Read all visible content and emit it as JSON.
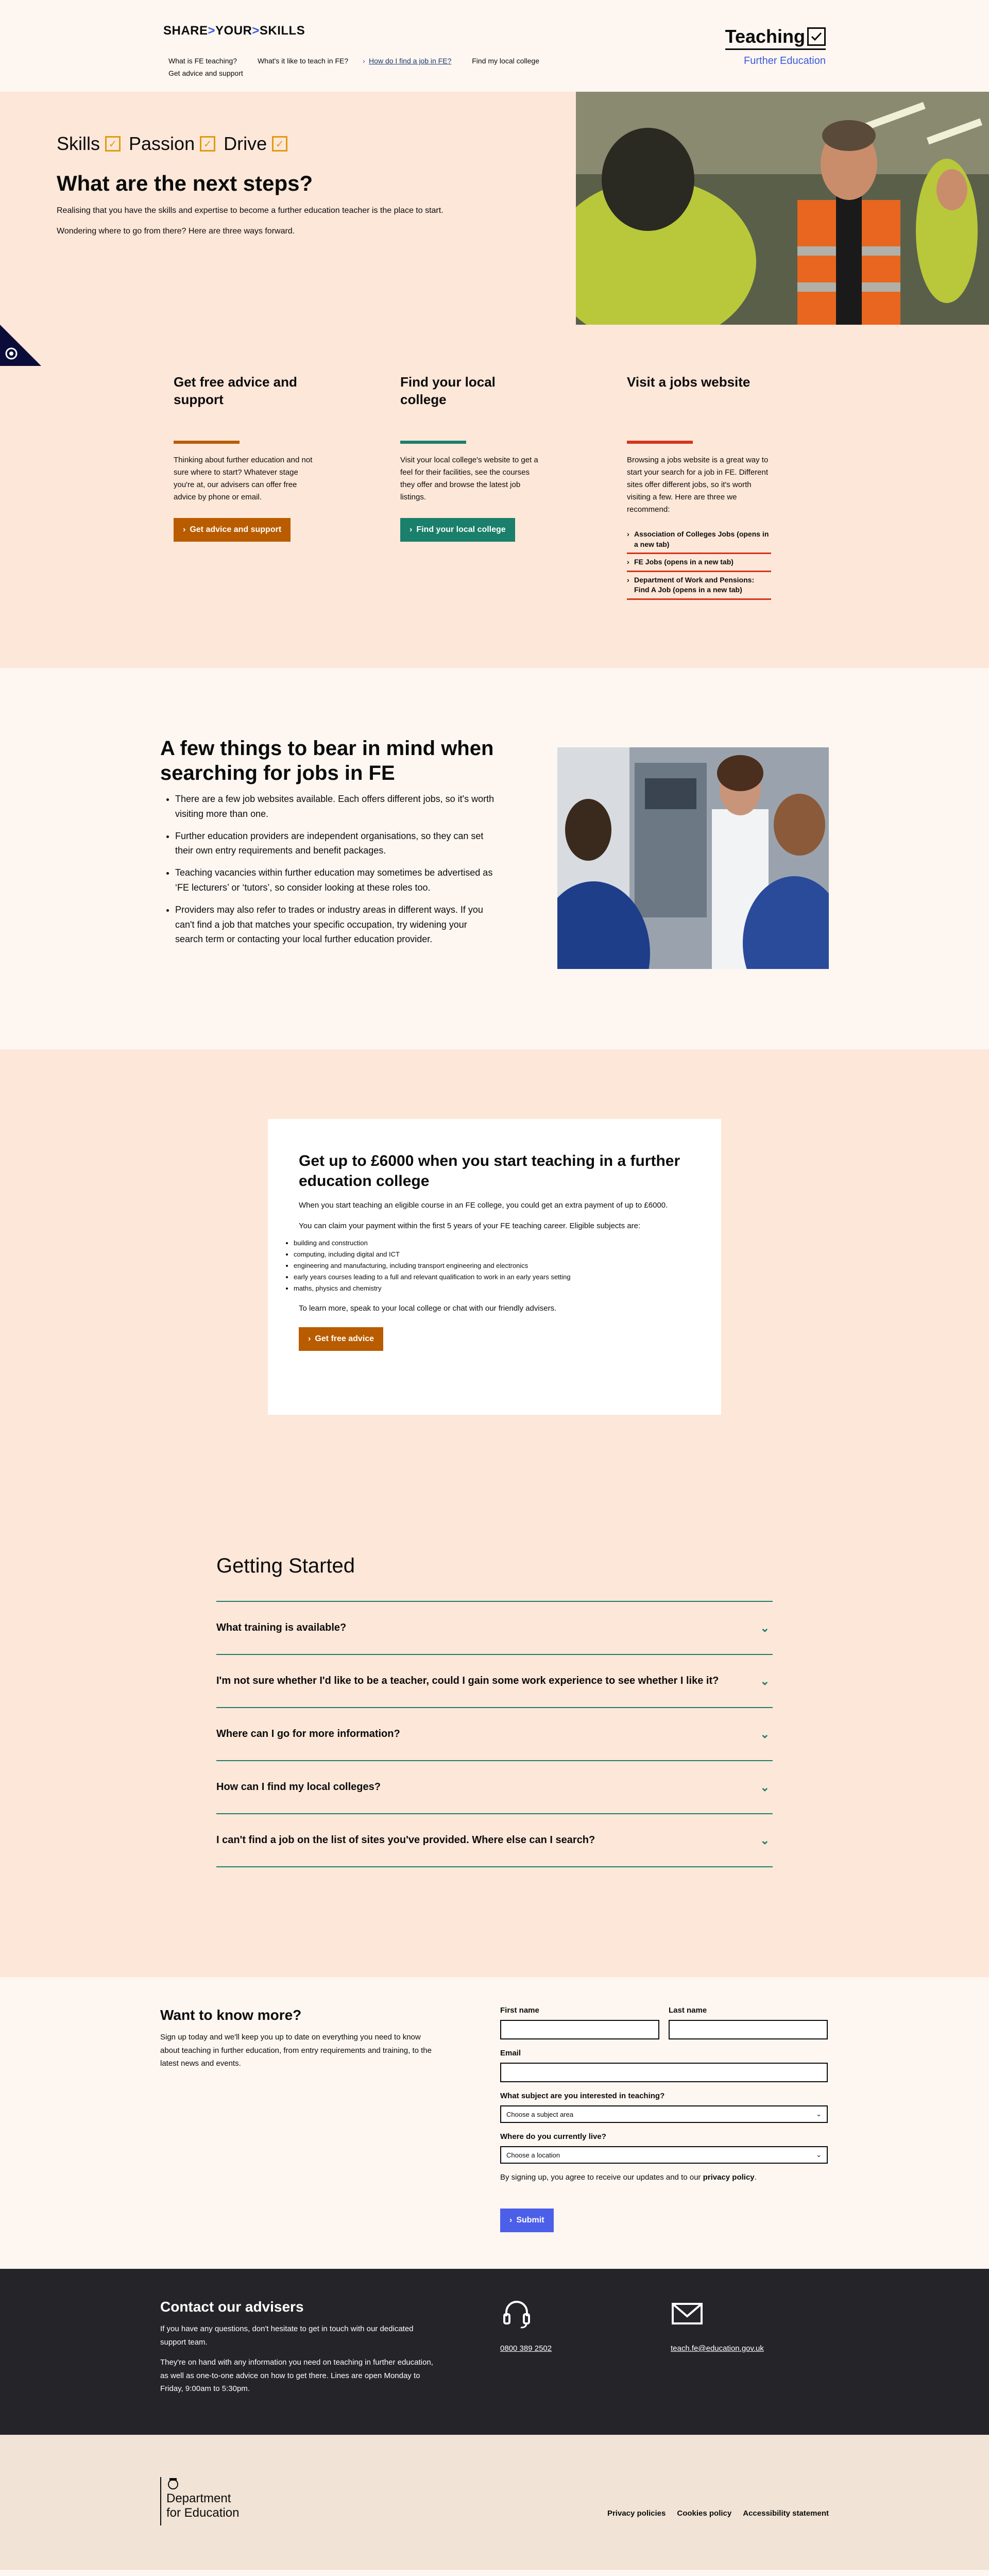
{
  "header": {
    "logo_share": "SHARE",
    "logo_your": "YOUR",
    "logo_skills": "SKILLS",
    "brand_title": "Teaching",
    "brand_sub": "Further Education",
    "nav": [
      "What is FE teaching?",
      "What's it like to teach in FE?",
      "How do I find a job in FE?",
      "Find my local college",
      "Get advice and support"
    ]
  },
  "hero": {
    "pills": [
      "Skills",
      "Passion",
      "Drive"
    ],
    "title": "What are the next steps?",
    "p1": "Realising that you have the skills and expertise to become a further education teacher is the place to start.",
    "p2": "Wondering where to go from there? Here are three ways forward."
  },
  "steps": {
    "col1": {
      "title": "Get free advice and support",
      "text": "Thinking about further education and not sure where to start? Whatever stage you're at, our advisers can offer free advice by phone or email.",
      "button": "Get advice and support",
      "rule_color": "#b95c00"
    },
    "col2": {
      "title": "Find your local college",
      "text": "Visit your local college's website to get a feel for their facilities, see the courses they offer and browse the latest job listings.",
      "button": "Find your local college",
      "rule_color": "#1a7f6b"
    },
    "col3": {
      "title": "Visit a jobs website",
      "text": "Browsing a jobs website is a great way to start your search for a job in FE. Different sites offer different jobs, so it's worth visiting a few. Here are three we recommend:",
      "rule_color": "#d4351c",
      "links": [
        "Association of Colleges Jobs (opens in a new tab)",
        "FE Jobs (opens in a new tab)",
        "Department of Work and Pensions: Find A Job (opens in a new tab)"
      ]
    }
  },
  "bear": {
    "title": "A few things to bear in mind when searching for jobs in FE",
    "items": [
      "There are a few job websites available. Each offers different jobs, so it's worth visiting more than one.",
      "Further education providers are independent organisations, so they can set their own entry requirements and benefit packages.",
      "Teaching vacancies within further education may sometimes be advertised as ‘FE lecturers’ or ‘tutors’, so consider looking at these roles too.",
      "Providers may also refer to trades or industry areas in different ways. If you can't find a job that matches your specific occupation, try widening your search term or contacting your local further education provider."
    ]
  },
  "pay": {
    "title": "Get up to £6000 when you start teaching in a further education college",
    "p1": "When you start teaching an eligible course in an FE college, you could get an extra payment of up to £6000.",
    "p2": "You can claim your payment within the first 5 years of your FE teaching career. Eligible subjects are:",
    "subjects": [
      "building and construction",
      "computing, including digital and ICT",
      "engineering and manufacturing, including transport engineering and electronics",
      "early years courses leading to a full and relevant qualification to work in an early years setting",
      "maths, physics and chemistry"
    ],
    "p3": "To learn more, speak to your local college or chat with our friendly advisers.",
    "button": "Get free advice"
  },
  "faq": {
    "title": "Getting Started",
    "items": [
      "What training is available?",
      "I'm not sure whether I'd like to be a teacher, could I gain some work experience to see whether I like it?",
      "Where can I go for more information?",
      "How can I find my local colleges?",
      "I can't find a job on the list of sites you've provided. Where else can I search?"
    ]
  },
  "signup": {
    "title": "Want to know more?",
    "desc": "Sign up today and we'll keep you up to date on everything you need to know about teaching in further education, from entry requirements and training, to the latest news and events.",
    "first_name": "First name",
    "last_name": "Last name",
    "email": "Email",
    "subject_label": "What subject are you interested in teaching?",
    "subject_value": "Choose a subject area",
    "location_label": "Where do you currently live?",
    "location_value": "Choose a location",
    "privacy_text": "By signing up, you agree to receive our updates and to our",
    "privacy_link": "privacy policy",
    "privacy_end": ".",
    "submit": "Submit"
  },
  "contact": {
    "title": "Contact our advisers",
    "p1": "If you have any questions, don't hesitate to get in touch with our dedicated support team.",
    "p2": "They're on hand with any information you need on teaching in further education, as well as one-to-one advice on how to get there. Lines are open Monday to Friday, 9:00am to 5:30pm.",
    "phone": "0800 389 2502",
    "email": "teach.fe@education.gov.uk"
  },
  "footer": {
    "dfe_line1": "Department",
    "dfe_line2": "for Education",
    "links": [
      "Privacy policies",
      "Cookies policy",
      "Accessibility statement"
    ]
  },
  "colors": {
    "accent_orange": "#b95c00",
    "accent_teal": "#1a7f6b",
    "accent_red": "#d4351c",
    "accent_blue": "#4c5fe8",
    "hero_bg": "#fde7d8",
    "page_bg": "#fdf6f1",
    "dark_bg": "#252429"
  }
}
